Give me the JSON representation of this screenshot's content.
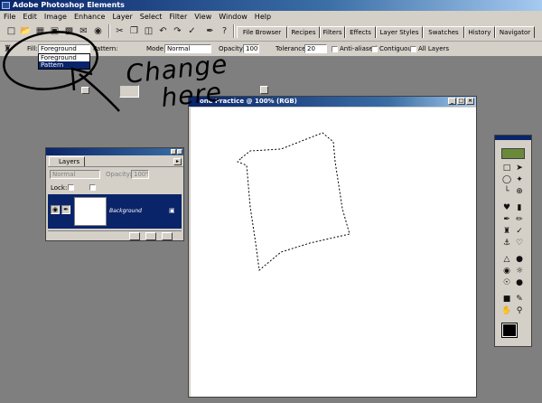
{
  "window": {
    "title": "Adobe Photoshop Elements"
  },
  "menu": [
    "File",
    "Edit",
    "Image",
    "Enhance",
    "Layer",
    "Select",
    "Filter",
    "View",
    "Window",
    "Help"
  ],
  "toolbar": {
    "tabs": [
      "File Browser",
      "Recipes",
      "Filters",
      "Effects",
      "Layer Styles",
      "Swatches",
      "History",
      "Navigator"
    ]
  },
  "options": {
    "fill_label": "Fill:",
    "fill_value": "Foreground",
    "pattern_label": "Pattern:",
    "mode_label": "Mode:",
    "mode_value": "Normal",
    "opacity_label": "Opacity:",
    "opacity_value": "100%",
    "tolerance_label": "Tolerance:",
    "tolerance_value": "20",
    "anti_aliased": "Anti-aliased",
    "contiguous": "Contiguous",
    "all_layers": "All Layers",
    "dropdown_options": [
      "Foreground",
      "Pattern"
    ],
    "dropdown_selected": "Pattern"
  },
  "layers": {
    "tab": "Layers",
    "blend_mode": "Normal",
    "opacity_label": "Opacity:",
    "opacity_value": "100%",
    "lock_label": "Lock:",
    "layer_name": "Background"
  },
  "document": {
    "title": "one Practice @ 100% (RGB)"
  },
  "annotation": {
    "line1": "Change",
    "line2": "here"
  },
  "colors": {
    "titlebar": "#0a246a",
    "chrome": "#d4d0c8",
    "workspace": "#7f7f7f",
    "selected": "#0a246a"
  }
}
